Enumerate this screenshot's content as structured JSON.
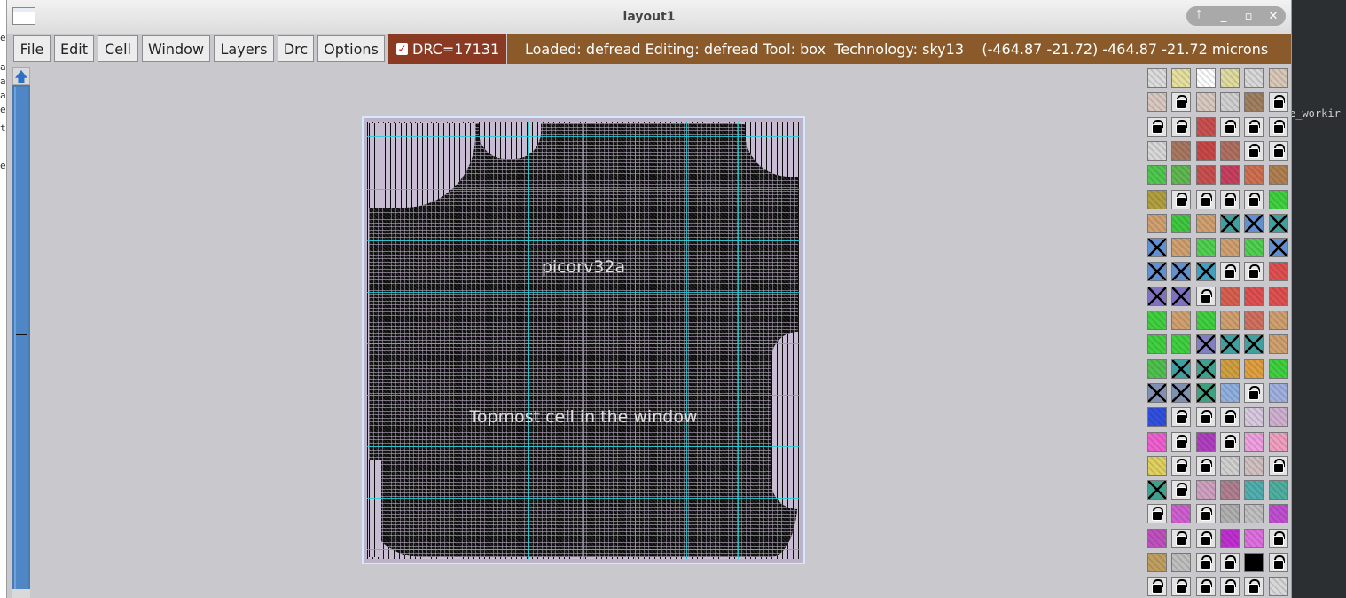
{
  "window": {
    "title": "layout1"
  },
  "background_terminal": {
    "right_text": "e_workir",
    "left_letters": [
      "e",
      "a",
      "a",
      "a",
      "e",
      "t",
      "e"
    ]
  },
  "menu": {
    "items": [
      "File",
      "Edit",
      "Cell",
      "Window",
      "Layers",
      "Drc",
      "Options"
    ]
  },
  "drc": {
    "label": "DRC=17131",
    "checked": true
  },
  "status": {
    "text": "Loaded: defread Editing: defread Tool: box  Technology: sky13    (-464.87 -21.72) -464.87 -21.72 microns"
  },
  "canvas": {
    "cell_name": "picorv32a",
    "cell_hint": "Topmost cell in the window"
  },
  "palette": {
    "columns": 6,
    "swatches": [
      [
        "#dcdcdc",
        "#e6e0a0",
        "#ffffff",
        "#e0dca0",
        "#d8d8d8",
        "#d8c8b8"
      ],
      [
        "#d8c8c0",
        "lock",
        "#d8c8c0",
        "#d0d0d0",
        "#a08060",
        "lock"
      ],
      [
        "lock",
        "lock",
        "#c85050",
        "lock",
        "lock",
        "lock"
      ],
      [
        "#d8d8d8",
        "#a87860",
        "#c84848",
        "#b07060",
        "lock",
        "lock"
      ],
      [
        "#50c850",
        "#60b850",
        "#c85050",
        "#c84060",
        "#d07050",
        "#b08050"
      ],
      [
        "#b0a040",
        "lock",
        "lock",
        "lock",
        "lock",
        "#40d040"
      ],
      [
        "#d0a070",
        "#40c840",
        "#d0a070",
        "x:#40a0a0",
        "x:#6090d0",
        "x:#40a0a0"
      ],
      [
        "x:#6090d0",
        "#d0a070",
        "#50d050",
        "#d0a070",
        "#50d050",
        "x:#6090d0"
      ],
      [
        "x:#6090d0",
        "x:#6090d0",
        "x:#40a0c0",
        "lock",
        "lock",
        "#e05050"
      ],
      [
        "x:#8070c0",
        "x:#8070c0",
        "lock",
        "#d86050",
        "#e05050",
        "#e05050"
      ],
      [
        "#40d040",
        "#d0a070",
        "#40d040",
        "#d0a070",
        "#d07060",
        "#d0a070"
      ],
      [
        "#40d040",
        "#40d040",
        "x:#8080c0",
        "x:#40a0a0",
        "x:#40a0a0",
        "#d0a070"
      ],
      [
        "#50c050",
        "x:#40a0a0",
        "x:#40a090",
        "#d0a040",
        "#e0a040",
        "#40d040"
      ],
      [
        "x:#8090b0",
        "x:#8090b0",
        "x:#40a080",
        "#90b0e0",
        "lock",
        "#a0b0e0"
      ],
      [
        "#3050e0",
        "lock",
        "lock",
        "lock",
        "#d8c8e0",
        "#d0b0d0"
      ],
      [
        "#f060d0",
        "lock",
        "#b040c0",
        "lock",
        "#f0a0e0",
        "#f0a0c0"
      ],
      [
        "#e0d060",
        "lock",
        "lock",
        "#d0d0d0",
        "#d0c0c0",
        "lock"
      ],
      [
        "x:#40a090",
        "lock",
        "#d0a0c0",
        "#b08090",
        "#50b0b0",
        "#50b0a0"
      ],
      [
        "lock",
        "#d060d0",
        "lock",
        "#b0b0b0",
        "#c0c0c0",
        "#c050d0"
      ],
      [
        "#c050c0",
        "lock",
        "lock",
        "#c030d0",
        "#e070e0",
        "lock"
      ],
      [
        "#c0a060",
        "#c0c0c0",
        "lock",
        "lock",
        "#000000",
        "lock"
      ],
      [
        "lock",
        "lock",
        "lock",
        "lock",
        "lock",
        "#d8d8d8"
      ]
    ]
  }
}
